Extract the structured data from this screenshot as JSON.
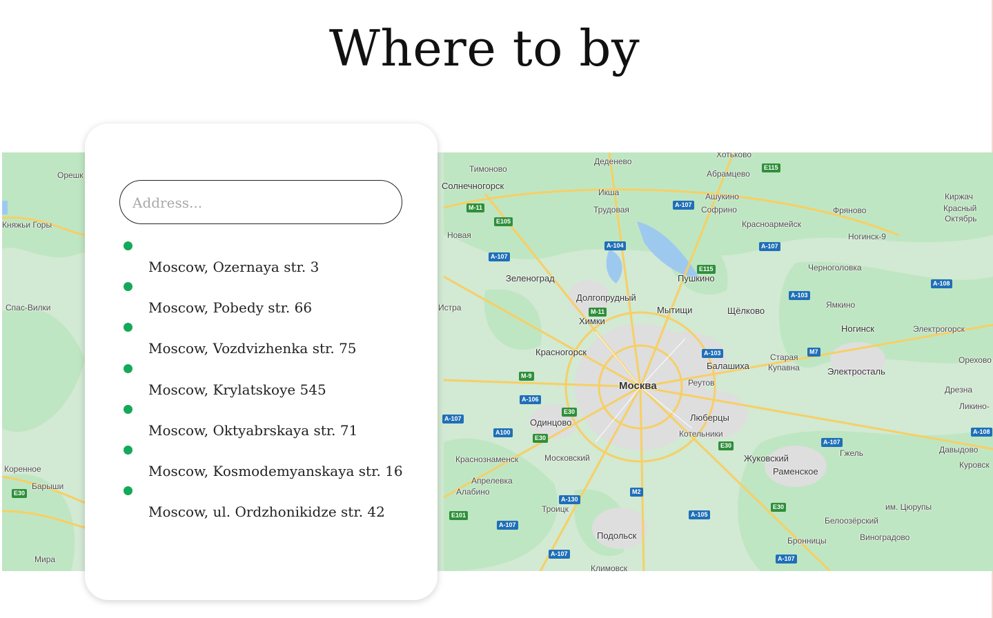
{
  "title": "Where to by",
  "search": {
    "placeholder": "Address..."
  },
  "addresses": [
    "Moscow, Ozernaya str. 3",
    "Moscow, Pobedy str. 66",
    "Moscow, Vozdvizhenka str. 75",
    "Moscow, Krylatskoye 545",
    "Moscow, Oktyabrskaya str. 71",
    "Moscow, Kosmodemyanskaya str. 16",
    "Moscow, ul. Ordzhonikidze str. 42"
  ],
  "colors": {
    "marker": "#14a85a",
    "forest": "#bfe6c2",
    "urban": "#e1e1e1",
    "road": "#f6cf65",
    "water": "#9ec9ef"
  },
  "map": {
    "labels": {
      "oreshki": "Орешк",
      "knyazhi": "Княжьи Горы",
      "spas": "Спас-Вилки",
      "korennoe": "Коренное",
      "baryshi": "Барыши",
      "mira": "Мира",
      "timonovo": "Тимоново",
      "solnech": "Солнечногорск",
      "novaya": "Новая",
      "zelenograd": "Зеленоград",
      "istra": "Истра",
      "dedenevo": "Деденево",
      "iksha": "Икша",
      "trudovaya": "Трудовая",
      "dolgoprud": "Долгопрудный",
      "khimki": "Химки",
      "krasnogorsk": "Красногорск",
      "moskva": "Москва",
      "odintsovo": "Одинцово",
      "krasnoznam": "Краснознаменск",
      "moskovsky": "Московский",
      "aprelevka": "Апрелевка",
      "alabino": "Алабино",
      "troitsk": "Троицк",
      "podolsk": "Подольск",
      "klimovsk": "Климовск",
      "khotkovo": "Хотьково",
      "abramtsevo": "Абрамцево",
      "ashukino": "Ашукино",
      "sofrino": "Софрино",
      "krasnoarm": "Красноармейск",
      "pushkino": "Пушкино",
      "mytishchi": "Мытищи",
      "shchelkovo": "Щёлково",
      "balashikha": "Балашиха",
      "reutov": "Реутов",
      "staraya": "Старая",
      "kupavna": "Купавна",
      "lyubertsy": "Люберцы",
      "kotelniki": "Котельники",
      "zhukovsky": "Жуковский",
      "ramenskoe": "Раменское",
      "fryanovo": "Фряново",
      "noginsk9": "Ногинск-9",
      "chernogolovka": "Черноголовка",
      "yamkino": "Ямкино",
      "noginsk": "Ногинск",
      "elektrougli": "Электрогорск",
      "elektrostal": "Электросталь",
      "kirzhach": "Киржач",
      "krasny": "Красный",
      "oktyabr": "Октябрь",
      "orekhovo": "Орехово",
      "drezna": "Дрезна",
      "likino": "Ликино-",
      "davydovo": "Давыдово",
      "kurovskoe": "Куровск",
      "gzhel": "Гжель",
      "tsyurupy": "им. Цюрупы",
      "beloozersky": "Белоозёрский",
      "bronnitsy": "Бронницы",
      "vinogradovo": "Виноградово"
    },
    "shields": {
      "m11a": "M-11",
      "e105": "E105",
      "a107a": "A-107",
      "m9": "M-9",
      "a106": "A-106",
      "a107b": "A-107",
      "a100": "A100",
      "e30a": "E30",
      "e30b": "E30",
      "m11b": "M-11",
      "a104": "A-104",
      "a107c": "A-107",
      "e115a": "E115",
      "e115b": "E115",
      "a107d": "A-107",
      "a103a": "A-103",
      "a103b": "A-103",
      "m7": "M7",
      "a108a": "A-108",
      "a108b": "A-108",
      "a107e": "A-107",
      "e30c": "E30",
      "a130": "A-130",
      "m2": "M2",
      "a105": "A-105",
      "e30d": "E30",
      "a107f": "A-107",
      "e101": "E101",
      "a107g": "A-107",
      "a107h": "A-107",
      "e30e": "E30"
    }
  }
}
